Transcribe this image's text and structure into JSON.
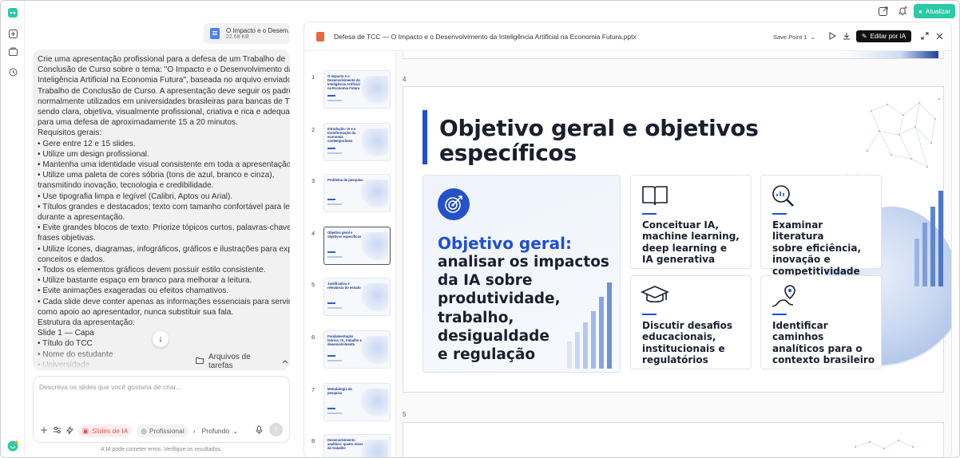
{
  "rail": {
    "icons": [
      "app-logo-icon",
      "new-chat-icon",
      "projects-icon",
      "history-icon",
      "account-icon"
    ]
  },
  "topbar": {
    "upgrade_label": "Atualizar",
    "accent": "#2bc9a6"
  },
  "attachment": {
    "name": "O Impacto e o Desenvo...",
    "size": "22.68 KB"
  },
  "prompt_lines": [
    "Crie uma apresentação profissional para a defesa de um Trabalho de",
    "Conclusão de Curso sobre o tema: \"O Impacto e o Desenvolvimento da",
    "Inteligência Artificial na Economia Futura\", baseada no arquivo enviado do",
    "Trabalho de Conclusão de Curso. A apresentação deve seguir os padrões",
    "normalmente utilizados em universidades brasileiras para bancas de TCC,",
    "sendo clara, objetiva, visualmente profissional, criativa e rica e adequada",
    "para uma defesa de aproximadamente 15 a 20 minutos.",
    "Requisitos gerais:",
    "• Gere entre 12 e 15 slides.",
    "• Utilize um design profissional.",
    "• Mantenha uma identidade visual consistente em toda a apresentação.",
    "• Utilize uma paleta de cores sóbria (tons de azul, branco e cinza),",
    "transmitindo inovação, tecnologia e credibilidade.",
    "• Use tipografia limpa e legível (Calibri, Aptos ou Arial).",
    "• Títulos grandes e destacados; texto com tamanho confortável para leitura",
    "durante a apresentação.",
    "• Evite grandes blocos de texto. Priorize tópicos curtos, palavras-chave e",
    "frases objetivas.",
    "• Utilize ícones, diagramas, infográficos, gráficos e ilustrações para explicar",
    "conceitos e dados.",
    "• Todos os elementos gráficos devem possuir estilo consistente.",
    "• Utilize bastante espaço em branco para melhorar a leitura.",
    "• Evite animações exageradas ou efeitos chamativos.",
    "• Cada slide deve conter apenas as informações essenciais para servir",
    "como apoio ao apresentador, nunca substituir sua fala.",
    "Estrutura da apresentação:",
    "Slide 1 — Capa",
    "• Título do TCC",
    "• Nome do estudante",
    "• Universidade"
  ],
  "tasks_label": "Arquivos de tarefas",
  "composer": {
    "placeholder": "Descreva os slides que você gostaria de criar...",
    "mode_slides": "Slides de IA",
    "mode_style": "Profissional",
    "mode_depth": "Profundo",
    "disclaimer": "A IA pode cometer erros. Verifique os resultados."
  },
  "viewer": {
    "file_title": "Defesa de TCC — O Impacto e o Desenvolvimento da Inteligência Artificial na Economia Futura.pptx",
    "save_point": "Save Point 1",
    "edit_label": "Editar por IA"
  },
  "thumbnails": [
    {
      "num": "1",
      "title": "O Impacto e o Desenvolvimento da Inteligência Artificial na Economia Futura"
    },
    {
      "num": "2",
      "title": "Introdução: IA e a transformação da economia contemporânea"
    },
    {
      "num": "3",
      "title": "Problema de pesquisa"
    },
    {
      "num": "4",
      "title": "Objetivo geral e objetivos específicos"
    },
    {
      "num": "5",
      "title": "Justificativa e relevância do estudo"
    },
    {
      "num": "6",
      "title": "Fundamentação teórica: IA, trabalho e desenvolvimento"
    },
    {
      "num": "7",
      "title": "Metodologia da pesquisa"
    },
    {
      "num": "8",
      "title": "Desenvolvimento analítico: quatro eixos do trabalho"
    }
  ],
  "slide4": {
    "num": "4",
    "title_l1": "Objetivo geral e objetivos",
    "title_l2": "específicos",
    "goal_label": "Objetivo geral:",
    "goal_lines": [
      "analisar os impactos",
      "da IA sobre",
      "produtividade,",
      "trabalho, desigualdade",
      "e regulação"
    ],
    "cards": [
      {
        "lines": [
          "Conceituar IA,",
          "machine learning,",
          "deep learning e",
          "IA generativa"
        ],
        "icon": "book-icon"
      },
      {
        "lines": [
          "Examinar literatura",
          "sobre eficiência,",
          "inovação e",
          "competitividade"
        ],
        "icon": "magnifier-chart-icon"
      },
      {
        "lines": [
          "Discutir desafios",
          "educacionais,",
          "institucionais e",
          "regulatórios"
        ],
        "icon": "graduation-cap-icon"
      },
      {
        "lines": [
          "Identificar caminhos",
          "analíticos para o",
          "contexto brasileiro"
        ],
        "icon": "route-pin-icon"
      }
    ],
    "accent": "#1f4fd1"
  },
  "slide5": {
    "num": "5"
  }
}
